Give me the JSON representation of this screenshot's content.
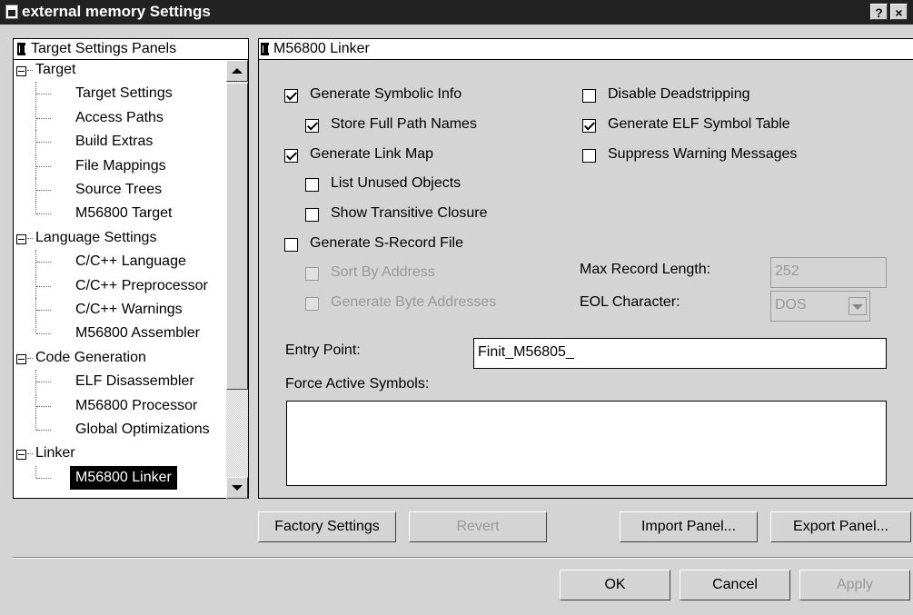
{
  "window": {
    "title": "external memory Settings",
    "help_label": "?",
    "close_label": "×"
  },
  "left_panel": {
    "header": "Target Settings Panels",
    "tree": [
      {
        "label": "Target",
        "level": 0
      },
      {
        "label": "Target Settings",
        "level": 1
      },
      {
        "label": "Access Paths",
        "level": 1
      },
      {
        "label": "Build Extras",
        "level": 1
      },
      {
        "label": "File Mappings",
        "level": 1
      },
      {
        "label": "Source Trees",
        "level": 1
      },
      {
        "label": "M56800 Target",
        "level": 1
      },
      {
        "label": "Language Settings",
        "level": 0
      },
      {
        "label": "C/C++ Language",
        "level": 1
      },
      {
        "label": "C/C++ Preprocessor",
        "level": 1
      },
      {
        "label": "C/C++ Warnings",
        "level": 1
      },
      {
        "label": "M56800 Assembler",
        "level": 1
      },
      {
        "label": "Code Generation",
        "level": 0
      },
      {
        "label": "ELF Disassembler",
        "level": 1
      },
      {
        "label": "M56800 Processor",
        "level": 1
      },
      {
        "label": "Global Optimizations",
        "level": 1
      },
      {
        "label": "Linker",
        "level": 0
      },
      {
        "label": "M56800 Linker",
        "level": 1,
        "selected": true
      }
    ]
  },
  "right_panel": {
    "header": "M56800 Linker",
    "options": {
      "generate_symbolic_info": {
        "label": "Generate Symbolic Info",
        "checked": true
      },
      "store_full_path_names": {
        "label": "Store Full Path Names",
        "checked": true
      },
      "generate_link_map": {
        "label": "Generate Link Map",
        "checked": true
      },
      "list_unused_objects": {
        "label": "List Unused Objects",
        "checked": false
      },
      "show_transitive_closure": {
        "label": "Show Transitive Closure",
        "checked": false
      },
      "generate_srecord_file": {
        "label": "Generate S-Record File",
        "checked": false
      },
      "sort_by_address": {
        "label": "Sort By Address",
        "checked": false,
        "disabled": true
      },
      "generate_byte_addresses": {
        "label": "Generate Byte Addresses",
        "checked": false,
        "disabled": true
      },
      "disable_deadstripping": {
        "label": "Disable Deadstripping",
        "checked": false
      },
      "generate_elf_symbol_table": {
        "label": "Generate ELF Symbol Table",
        "checked": true
      },
      "suppress_warning_messages": {
        "label": "Suppress Warning Messages",
        "checked": false
      }
    },
    "max_record_length": {
      "label": "Max Record Length:",
      "value": "252"
    },
    "eol_character": {
      "label": "EOL Character:",
      "value": "DOS"
    },
    "entry_point": {
      "label": "Entry Point:",
      "value": "Finit_M56805_"
    },
    "force_active_symbols": {
      "label": "Force Active Symbols:",
      "value": ""
    }
  },
  "panel_buttons": {
    "factory_settings": "Factory Settings",
    "revert": "Revert",
    "import_panel": "Import Panel...",
    "export_panel": "Export Panel..."
  },
  "dialog_buttons": {
    "ok": "OK",
    "cancel": "Cancel",
    "apply": "Apply"
  }
}
